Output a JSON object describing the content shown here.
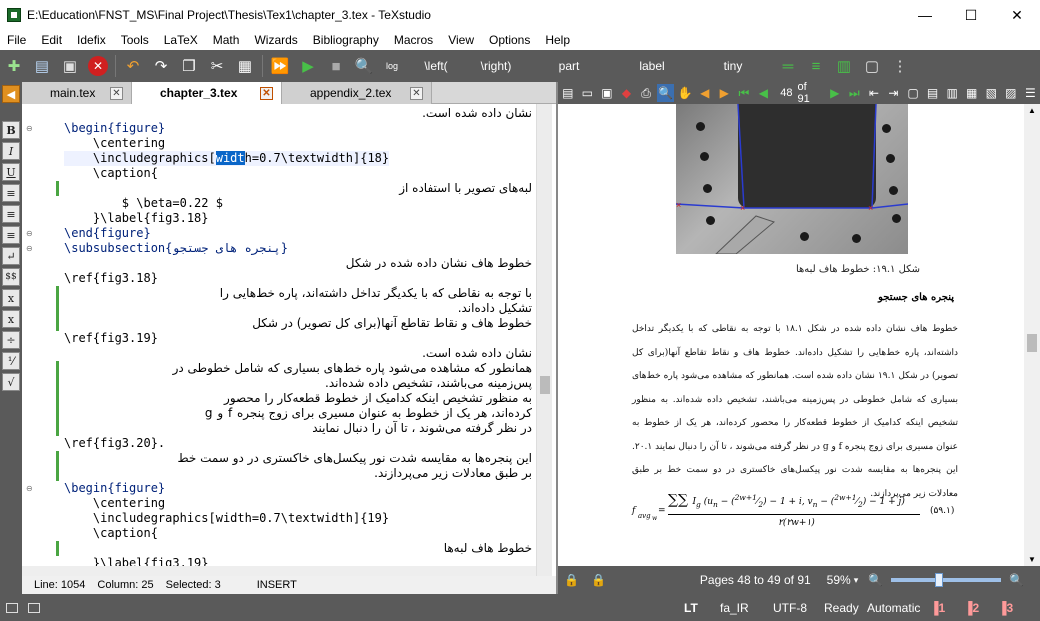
{
  "window": {
    "title": "E:\\Education\\FNST_MS\\Final Project\\Thesis\\Tex1\\chapter_3.tex - TeXstudio",
    "minimize_label": "—",
    "maximize_label": "☐",
    "close_label": "✕"
  },
  "menu": [
    "File",
    "Edit",
    "Idefix",
    "Tools",
    "LaTeX",
    "Math",
    "Wizards",
    "Bibliography",
    "Macros",
    "View",
    "Options",
    "Help"
  ],
  "toolbar": {
    "left_cmd": "\\left(",
    "right_cmd": "\\right)",
    "section_combo": "part",
    "label_combo": "label",
    "size_combo": "tiny"
  },
  "tabs": [
    {
      "label": "main.tex",
      "active": false
    },
    {
      "label": "chapter_3.tex",
      "active": true
    },
    {
      "label": "appendix_2.tex",
      "active": false
    }
  ],
  "editor": {
    "lines": [
      {
        "text": "نشان داده شده است.",
        "rtl": true
      },
      {
        "text": "\\begin{figure}",
        "kw": true
      },
      {
        "text": "    \\centering"
      },
      {
        "text": "    \\includegraphics[width=0.7\\textwidth]{18}",
        "current": true
      },
      {
        "text": "    \\caption{"
      },
      {
        "text": "لبه‌های تصویر با استفاده از",
        "rtl": true
      },
      {
        "text": "        $ \\beta=0.22 $"
      },
      {
        "text": "    }\\label{fig3.18}"
      },
      {
        "text": "\\end{figure}",
        "kw": true
      },
      {
        "text": "\\subsubsection{پنجره های جستجو}",
        "kw": true
      },
      {
        "text": "خطوط هاف نشان داده شده در شکل",
        "rtl": true
      },
      {
        "text": "\\ref{fig3.18}"
      },
      {
        "text": "با توجه به نقاطی که با یکدیگر تداخل داشته‌اند، پاره خط‌هایی را",
        "rtl": true
      },
      {
        "text": "تشکیل داده‌اند.",
        "rtl": true
      },
      {
        "text": "خطوط هاف و نقاط تقاطع آنها(برای کل تصویر) در شکل",
        "rtl": true
      },
      {
        "text": "\\ref{fig3.19}"
      },
      {
        "text": "نشان داده شده است.",
        "rtl": true
      },
      {
        "text": "همانطور که مشاهده می‌شود پاره خط‌های بسیاری که شامل خطوطی در",
        "rtl": true
      },
      {
        "text": "پس‌زمینه می‌باشند، تشخیص داده شده‌اند.",
        "rtl": true
      },
      {
        "text": "به منظور تشخیص اینکه کدامیک از خطوط قطعه‌کار را محصور",
        "rtl": true
      },
      {
        "text": "کرده‌اند، هر یک از خطوط به عنوان مسیری برای زوج پنجره f و g",
        "rtl": true
      },
      {
        "text": "در نظر گرفته می‌شوند ، تا آن را دنبال نمایند",
        "rtl": true
      },
      {
        "text": "\\ref{fig3.20}."
      },
      {
        "text": "این پنجره‌ها به مقایسه شدت نور پیکسل‌های خاکستری در دو سمت خط",
        "rtl": true
      },
      {
        "text": "بر طبق معادلات زیر می‌پردازند.",
        "rtl": true
      },
      {
        "text": "\\begin{figure}",
        "kw": true
      },
      {
        "text": "    \\centering"
      },
      {
        "text": "    \\includegraphics[width=0.7\\textwidth]{19}"
      },
      {
        "text": "    \\caption{"
      },
      {
        "text": "خطوط هاف لبه‌ها",
        "rtl": true
      },
      {
        "text": "    }\\label{fig3.19}"
      }
    ],
    "selected_word": "widt"
  },
  "status": {
    "line": "Line: 1054",
    "column": "Column: 25",
    "selected": "Selected: 3",
    "mode": "INSERT"
  },
  "pdf": {
    "page_display": "48",
    "page_total": "of 91",
    "pages_status": "Pages 48 to 49 of 91",
    "zoom": "59%",
    "figure_caption": "شکل ۱۹.۱: خطوط هاف لبه‌ها",
    "heading": "پنجره های جستجو",
    "paragraph": "خطوط هاف نشان داده شده در شکل ۱۸.۱ با توجه به نقاطی که با یکدیگر تداخل داشته‌اند، پاره خط‌هایی را تشکیل داده‌اند. خطوط هاف و نقاط تقاطع آنها(برای کل تصویر) در شکل ۱۹.۱ نشان داده شده است. همانطور که مشاهده می‌شود پاره خط‌های بسیاری که شامل خطوطی در پس‌زمینه می‌باشند، تشخیص داده شده‌اند. به منظور تشخیص اینکه کدامیک از خطوط قطعه‌کار را محصور کرده‌اند، هر یک از خطوط به عنوان مسیری برای زوج پنجره f و g در نظر گرفته می‌شوند ، تا آن را دنبال نمایند ۲۰.۱. این پنجره‌ها به مقایسه شدت نور پیکسل‌های خاکستری در دو سمت خط بر طبق معادلات زیر می‌پردازند.",
    "equation_lhs": "f",
    "equation_lhs_sub": "avg",
    "equation_lhs_sub2": "w",
    "equation_number": "(۵۹.۱)"
  },
  "bottom": {
    "lt": "LT",
    "lang": "fa_IR",
    "encoding": "UTF-8",
    "ready": "Ready",
    "automatic": "Automatic",
    "b1": "1",
    "b2": "2",
    "b3": "3"
  }
}
